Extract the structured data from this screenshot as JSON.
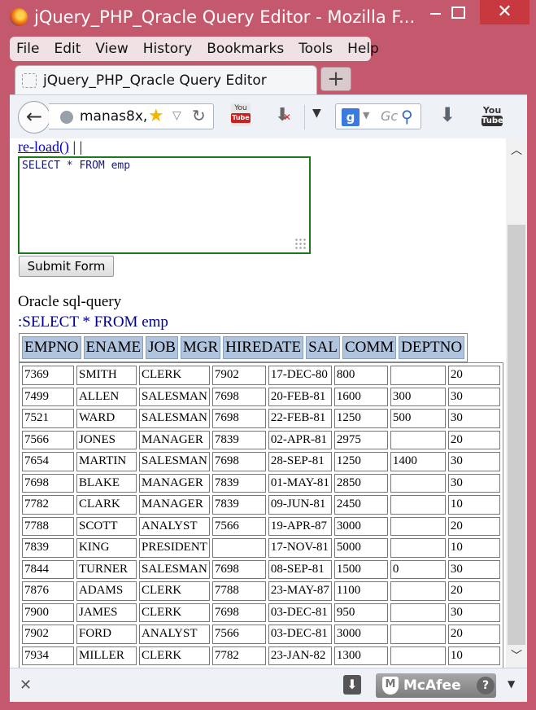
{
  "window": {
    "title": "jQuery_PHP_Qracle Query Editor - Mozilla F..."
  },
  "menu": [
    "File",
    "Edit",
    "View",
    "History",
    "Bookmarks",
    "Tools",
    "Help"
  ],
  "tab": {
    "title": "jQuery_PHP_Qracle Query Editor",
    "new_tab_label": "+"
  },
  "navbar": {
    "url": "manas8x,",
    "search_placeholder": "Gc"
  },
  "page": {
    "reload_link": "re-load()",
    "reload_suffix": " | |",
    "sql_text": "SELECT * FROM emp",
    "submit_label": "Submit Form",
    "oracle_label": "Oracle sql-query",
    "query_label": ":SELECT * FROM emp",
    "columns": [
      "EMPNO",
      "ENAME",
      "JOB",
      "MGR",
      "HIREDATE",
      "SAL",
      "COMM",
      "DEPTNO"
    ],
    "rows": [
      [
        "7369",
        "SMITH",
        "CLERK",
        "7902",
        "17-DEC-80",
        "800",
        "",
        "20"
      ],
      [
        "7499",
        "ALLEN",
        "SALESMAN",
        "7698",
        "20-FEB-81",
        "1600",
        "300",
        "30"
      ],
      [
        "7521",
        "WARD",
        "SALESMAN",
        "7698",
        "22-FEB-81",
        "1250",
        "500",
        "30"
      ],
      [
        "7566",
        "JONES",
        "MANAGER",
        "7839",
        "02-APR-81",
        "2975",
        "",
        "20"
      ],
      [
        "7654",
        "MARTIN",
        "SALESMAN",
        "7698",
        "28-SEP-81",
        "1250",
        "1400",
        "30"
      ],
      [
        "7698",
        "BLAKE",
        "MANAGER",
        "7839",
        "01-MAY-81",
        "2850",
        "",
        "30"
      ],
      [
        "7782",
        "CLARK",
        "MANAGER",
        "7839",
        "09-JUN-81",
        "2450",
        "",
        "10"
      ],
      [
        "7788",
        "SCOTT",
        "ANALYST",
        "7566",
        "19-APR-87",
        "3000",
        "",
        "20"
      ],
      [
        "7839",
        "KING",
        "PRESIDENT",
        "",
        "17-NOV-81",
        "5000",
        "",
        "10"
      ],
      [
        "7844",
        "TURNER",
        "SALESMAN",
        "7698",
        "08-SEP-81",
        "1500",
        "0",
        "30"
      ],
      [
        "7876",
        "ADAMS",
        "CLERK",
        "7788",
        "23-MAY-87",
        "1100",
        "",
        "20"
      ],
      [
        "7900",
        "JAMES",
        "CLERK",
        "7698",
        "03-DEC-81",
        "950",
        "",
        "30"
      ],
      [
        "7902",
        "FORD",
        "ANALYST",
        "7566",
        "03-DEC-81",
        "3000",
        "",
        "20"
      ],
      [
        "7934",
        "MILLER",
        "CLERK",
        "7782",
        "23-JAN-82",
        "1300",
        "",
        "10"
      ]
    ]
  },
  "statusbar": {
    "mcafee_label": "McAfee",
    "mcafee_help": "?"
  },
  "colors": {
    "window_frame": "#c4586d",
    "header_cell": "#b0c4de",
    "link": "#0000cc",
    "textarea_border": "#1a7a1a"
  }
}
